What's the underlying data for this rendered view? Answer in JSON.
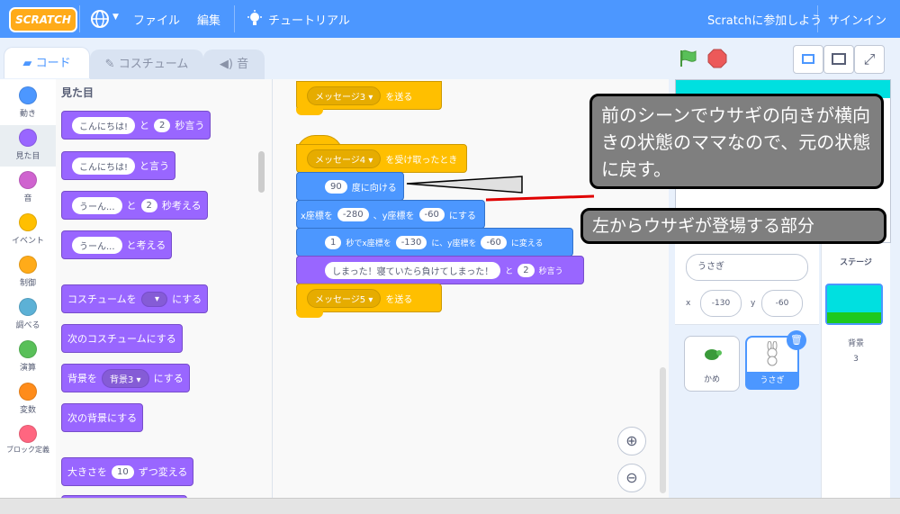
{
  "menubar": {
    "logo": "SCRATCH",
    "globe": "globe-icon",
    "file": "ファイル",
    "edit": "編集",
    "tutorial": "チュートリアル",
    "join": "Scratchに参加しよう",
    "signin": "サインイン"
  },
  "tabs": {
    "code": "コード",
    "costume": "コスチューム",
    "sound": "音"
  },
  "categories": [
    {
      "label": "動き",
      "color": "#4c97ff"
    },
    {
      "label": "見た目",
      "color": "#9966ff"
    },
    {
      "label": "音",
      "color": "#cf63cf"
    },
    {
      "label": "イベント",
      "color": "#ffbf00"
    },
    {
      "label": "制御",
      "color": "#ffab19"
    },
    {
      "label": "調べる",
      "color": "#5cb1d6"
    },
    {
      "label": "演算",
      "color": "#59c059"
    },
    {
      "label": "変数",
      "color": "#ff8c1a"
    },
    {
      "label": "ブロック定義",
      "color": "#ff6680"
    }
  ],
  "palette": {
    "heading": "見た目",
    "say_for": {
      "text": "こんにちは!",
      "and": "と",
      "secs": "2",
      "tail": "秒言う"
    },
    "say": {
      "text": "こんにちは!",
      "tail": "と言う"
    },
    "think_for": {
      "text": "うーん...",
      "and": "と",
      "secs": "2",
      "tail": "秒考える"
    },
    "think": {
      "text": "うーん...",
      "tail": "と考える"
    },
    "switch_costume": {
      "head": "コスチュームを",
      "tail": "にする"
    },
    "next_costume": "次のコスチュームにする",
    "switch_backdrop": {
      "head": "背景を",
      "value": "背景3",
      "tail": "にする"
    },
    "next_backdrop": "次の背景にする",
    "change_size": {
      "head": "大きさを",
      "value": "10",
      "tail": "ずつ変える"
    }
  },
  "script": {
    "broadcast3": {
      "value": "メッセージ3",
      "tail": "を送る"
    },
    "hat": {
      "value": "メッセージ4",
      "tail": "を受け取ったとき"
    },
    "point": {
      "value": "90",
      "tail": "度に向ける"
    },
    "goto": {
      "head": "x座標を",
      "x": "-280",
      "mid": "、y座標を",
      "y": "-60",
      "tail": "にする"
    },
    "glide": {
      "secs": "1",
      "mid1": "秒でx座標を",
      "x": "-130",
      "mid2": "に、y座標を",
      "y": "-60",
      "tail": "に変える"
    },
    "say_for": {
      "text": "しまった！寝ていたら負けてしまった！",
      "and": "と",
      "secs": "2",
      "tail": "秒言う"
    },
    "broadcast5": {
      "value": "メッセージ5",
      "tail": "を送る"
    }
  },
  "callouts": {
    "one": "前のシーンでウサギの向きが横向きの状態のママなので、元の状態に戻す。",
    "two": "左からウサギが登場する部分"
  },
  "sprite": {
    "name": "うさぎ",
    "x_label": "x",
    "x": "-130",
    "y_label": "y",
    "y": "-60"
  },
  "sprites": [
    {
      "name": "かめ"
    },
    {
      "name": "うさぎ"
    }
  ],
  "stage_panel": {
    "title": "ステージ",
    "backdrop_label": "背景",
    "backdrop_count": "3"
  }
}
